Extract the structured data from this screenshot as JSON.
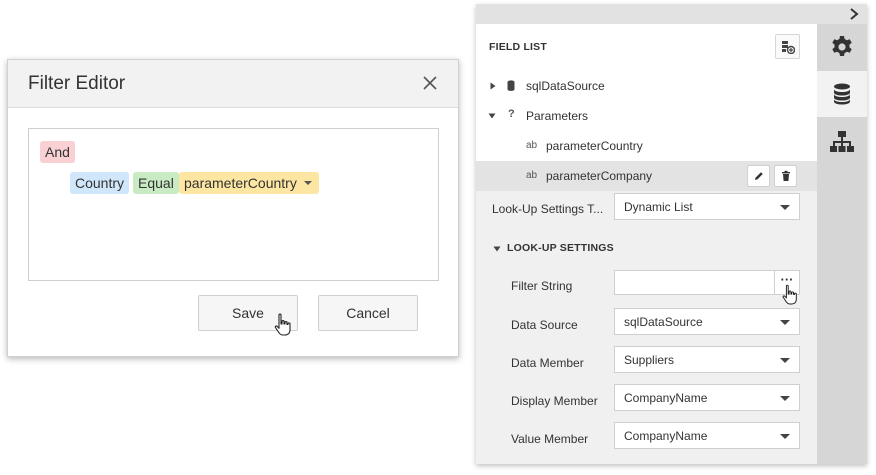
{
  "filter_editor": {
    "title": "Filter Editor",
    "group_operator": "And",
    "condition": {
      "field": "Country",
      "operator": "Equal",
      "value": "parameterCountry"
    },
    "save_label": "Save",
    "cancel_label": "Cancel"
  },
  "field_list": {
    "title": "FIELD LIST",
    "items": [
      {
        "label": "sqlDataSource",
        "icon": "database-icon",
        "icon_glyph": "▮",
        "expanded": false
      },
      {
        "label": "Parameters",
        "icon": "question-icon",
        "icon_glyph": "?",
        "expanded": true
      },
      {
        "label": "parameterCountry",
        "icon": "string-type-icon",
        "icon_glyph": "ab"
      },
      {
        "label": "parameterCompany",
        "icon": "string-type-icon",
        "icon_glyph": "ab",
        "selected": true
      }
    ]
  },
  "properties": {
    "lookup_settings_type": {
      "label": "Look-Up Settings T...",
      "value": "Dynamic List"
    },
    "section_title": "LOOK-UP SETTINGS",
    "filter_string": {
      "label": "Filter String",
      "value": "",
      "button": "···"
    },
    "data_source": {
      "label": "Data Source",
      "value": "sqlDataSource"
    },
    "data_member": {
      "label": "Data Member",
      "value": "Suppliers"
    },
    "display_member": {
      "label": "Display Member",
      "value": "CompanyName"
    },
    "value_member": {
      "label": "Value Member",
      "value": "CompanyName"
    }
  },
  "sidebar": {
    "tabs": [
      {
        "icon": "gear-icon",
        "active": false
      },
      {
        "icon": "database-icon",
        "active": true
      },
      {
        "icon": "hierarchy-icon",
        "active": false
      }
    ]
  },
  "colors": {
    "and_chip": "#f9d0d3",
    "field_chip": "#cfe6fb",
    "operator_chip": "#c9ebc4",
    "value_chip": "#fde6a2",
    "selected_row": "#e3e3e3"
  }
}
